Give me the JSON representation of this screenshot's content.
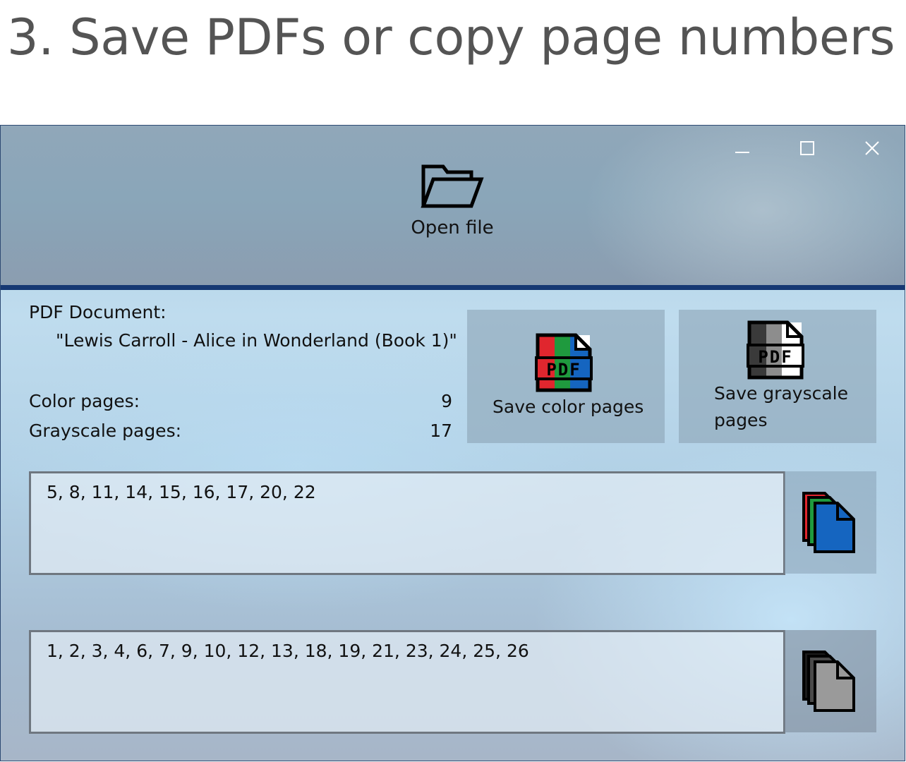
{
  "caption": "3. Save PDFs or copy page numbers",
  "toolbar": {
    "open_file_label": "Open file",
    "minimize_icon": "minimize-icon",
    "maximize_icon": "maximize-icon",
    "close_icon": "close-icon"
  },
  "document": {
    "heading": "PDF Document:",
    "name": "\"Lewis Carroll - Alice in Wonderland (Book 1)\""
  },
  "stats": {
    "color_label": "Color pages:",
    "color_count": "9",
    "gray_label": "Grayscale pages:",
    "gray_count": "17"
  },
  "buttons": {
    "save_color": "Save color pages",
    "save_gray_line1": "Save grayscale",
    "save_gray_line2": "pages"
  },
  "lists": {
    "color_pages": "5, 8, 11, 14, 15, 16, 17, 20, 22",
    "gray_pages": "1, 2, 3, 4, 6, 7, 9, 10, 12, 13, 18, 19, 21, 23, 24, 25, 26"
  },
  "colors": {
    "divider": "#163873",
    "pdf_red": "#e0262e",
    "pdf_green": "#1f9a3e",
    "pdf_blue": "#1565c0"
  }
}
